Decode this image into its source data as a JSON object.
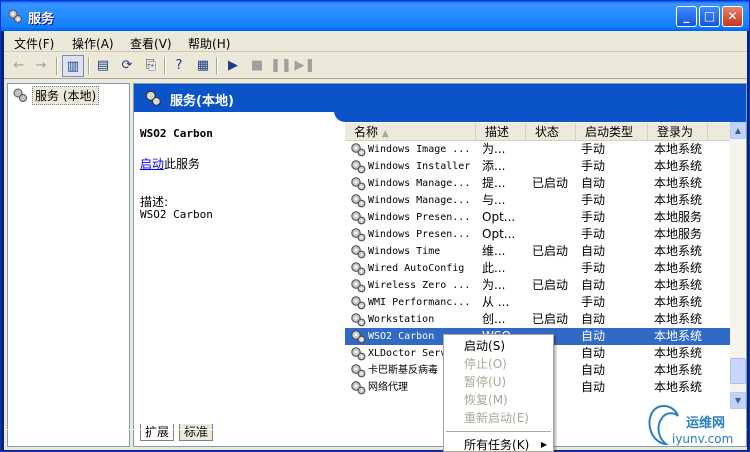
{
  "window": {
    "title": "服务",
    "minimize_icon": "minimize-icon",
    "maximize_icon": "maximize-icon",
    "close_icon": "close-icon"
  },
  "menu": [
    {
      "label": "文件",
      "key": "(F)"
    },
    {
      "label": "操作",
      "key": "(A)"
    },
    {
      "label": "查看",
      "key": "(V)"
    },
    {
      "label": "帮助",
      "key": "(H)"
    }
  ],
  "toolbar": {
    "icons": [
      "back-arrow-icon",
      "forward-arrow-icon",
      "show-hide-tree-icon",
      "properties-icon",
      "refresh-icon",
      "export-list-icon",
      "help-icon",
      "console-tree-icon",
      "start-icon",
      "stop-icon",
      "pause-icon",
      "restart-icon"
    ]
  },
  "tree": {
    "root_label": "服务 (本地)"
  },
  "banner": {
    "title": "服务(本地)"
  },
  "details": {
    "service_name": "WSO2 Carbon",
    "start_link": "启动",
    "start_suffix": "此服务",
    "desc_label": "描述:",
    "desc_text": "WSO2 Carbon"
  },
  "list": {
    "columns": [
      "名称",
      "描述",
      "状态",
      "启动类型",
      "登录为"
    ],
    "rows": [
      {
        "name": "Windows Image ...",
        "desc": "为...",
        "status": "",
        "startup": "手动",
        "logon": "本地系统"
      },
      {
        "name": "Windows Installer",
        "desc": "添...",
        "status": "",
        "startup": "手动",
        "logon": "本地系统"
      },
      {
        "name": "Windows Manage...",
        "desc": "提...",
        "status": "已启动",
        "startup": "自动",
        "logon": "本地系统"
      },
      {
        "name": "Windows Manage...",
        "desc": "与...",
        "status": "",
        "startup": "手动",
        "logon": "本地系统"
      },
      {
        "name": "Windows Presen...",
        "desc": "Opt...",
        "status": "",
        "startup": "手动",
        "logon": "本地服务"
      },
      {
        "name": "Windows Presen...",
        "desc": "Opt...",
        "status": "",
        "startup": "手动",
        "logon": "本地服务"
      },
      {
        "name": "Windows Time",
        "desc": "维...",
        "status": "已启动",
        "startup": "自动",
        "logon": "本地系统"
      },
      {
        "name": "Wired AutoConfig",
        "desc": "此...",
        "status": "",
        "startup": "手动",
        "logon": "本地系统"
      },
      {
        "name": "Wireless Zero ...",
        "desc": "为...",
        "status": "已启动",
        "startup": "自动",
        "logon": "本地系统"
      },
      {
        "name": "WMI Performanc...",
        "desc": "从 ...",
        "status": "",
        "startup": "手动",
        "logon": "本地系统"
      },
      {
        "name": "Workstation",
        "desc": "创...",
        "status": "已启动",
        "startup": "自动",
        "logon": "本地系统"
      },
      {
        "name": "WSO2 Carbon",
        "desc": "WSO...",
        "status": "",
        "startup": "自动",
        "logon": "本地系统"
      },
      {
        "name": "XLDoctor Serv",
        "desc": "",
        "status": "",
        "startup": "自动",
        "logon": "本地系统"
      },
      {
        "name": "卡巴斯基反病毒",
        "desc": "",
        "status": "",
        "startup": "自动",
        "logon": "本地系统"
      },
      {
        "name": "网络代理",
        "desc": "",
        "status": "",
        "startup": "自动",
        "logon": "本地系统"
      }
    ]
  },
  "tabs": [
    "扩展",
    "标准"
  ],
  "context_menu": {
    "items": [
      {
        "label": "启动",
        "key": "(S)",
        "enabled": true
      },
      {
        "label": "停止",
        "key": "(O)",
        "enabled": false
      },
      {
        "label": "暂停",
        "key": "(U)",
        "enabled": false
      },
      {
        "label": "恢复",
        "key": "(M)",
        "enabled": false
      },
      {
        "label": "重新启动",
        "key": "(E)",
        "enabled": false
      },
      {
        "label": "所有任务",
        "key": "(K)",
        "enabled": true
      }
    ]
  },
  "watermark": {
    "top": "运维网",
    "bottom": "iyunv.com"
  }
}
